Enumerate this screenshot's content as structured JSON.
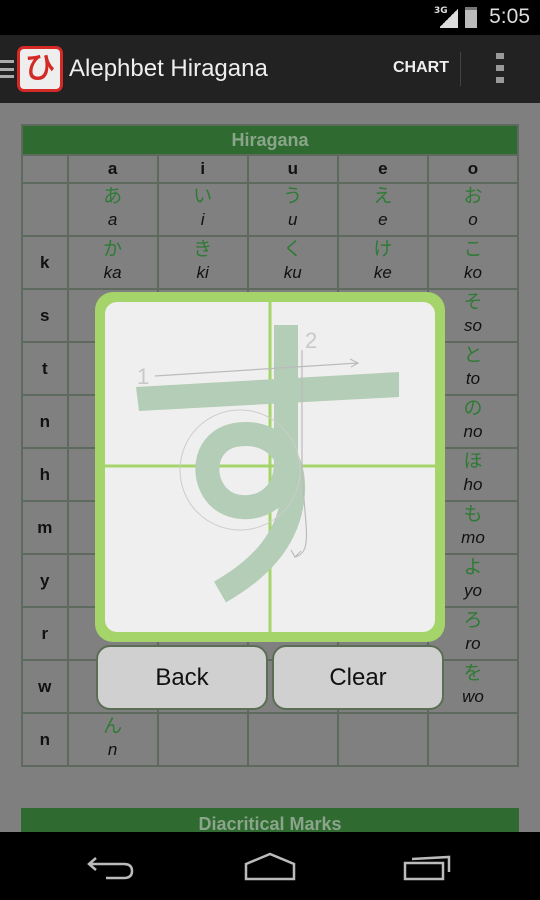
{
  "status_bar": {
    "network": "3G",
    "time": "5:05",
    "icons": [
      "signal-icon",
      "battery-charging-icon"
    ]
  },
  "action_bar": {
    "app_icon_glyph": "ひ",
    "title": "Alephbet Hiragana",
    "chart_label": "CHART",
    "icons": [
      "drawer-icon",
      "overflow-menu-icon"
    ]
  },
  "table": {
    "title": "Hiragana",
    "columns": [
      "a",
      "i",
      "u",
      "e",
      "o"
    ],
    "rows": [
      {
        "label": "",
        "cells": [
          {
            "kana": "あ",
            "romaji": "a"
          },
          {
            "kana": "い",
            "romaji": "i"
          },
          {
            "kana": "う",
            "romaji": "u"
          },
          {
            "kana": "え",
            "romaji": "e"
          },
          {
            "kana": "お",
            "romaji": "o"
          }
        ]
      },
      {
        "label": "k",
        "cells": [
          {
            "kana": "か",
            "romaji": "ka"
          },
          {
            "kana": "き",
            "romaji": "ki"
          },
          {
            "kana": "く",
            "romaji": "ku"
          },
          {
            "kana": "け",
            "romaji": "ke"
          },
          {
            "kana": "こ",
            "romaji": "ko"
          }
        ]
      },
      {
        "label": "s",
        "cells": [
          null,
          null,
          null,
          null,
          {
            "kana": "そ",
            "romaji": "so"
          }
        ]
      },
      {
        "label": "t",
        "cells": [
          null,
          null,
          null,
          null,
          {
            "kana": "と",
            "romaji": "to"
          }
        ]
      },
      {
        "label": "n",
        "cells": [
          null,
          null,
          null,
          null,
          {
            "kana": "の",
            "romaji": "no"
          }
        ]
      },
      {
        "label": "h",
        "cells": [
          null,
          null,
          null,
          null,
          {
            "kana": "ほ",
            "romaji": "ho"
          }
        ]
      },
      {
        "label": "m",
        "cells": [
          null,
          null,
          null,
          null,
          {
            "kana": "も",
            "romaji": "mo"
          }
        ]
      },
      {
        "label": "y",
        "cells": [
          null,
          null,
          null,
          null,
          {
            "kana": "よ",
            "romaji": "yo"
          }
        ]
      },
      {
        "label": "r",
        "cells": [
          null,
          null,
          null,
          null,
          {
            "kana": "ろ",
            "romaji": "ro"
          }
        ]
      },
      {
        "label": "w",
        "cells": [
          null,
          null,
          null,
          null,
          {
            "kana": "を",
            "romaji": "wo"
          }
        ]
      },
      {
        "label": "n",
        "cells": [
          {
            "kana": "ん",
            "romaji": "n"
          },
          null,
          null,
          null,
          null
        ]
      }
    ]
  },
  "next_section": {
    "title": "Diacritical Marks"
  },
  "dialog": {
    "character": "す",
    "stroke_numbers": [
      "1",
      "2"
    ],
    "back_label": "Back",
    "clear_label": "Clear"
  },
  "colors": {
    "frame": "#a5d46a",
    "header": "#2f6a31",
    "kana": "#2f7a35",
    "stroke": "#b3cdb6"
  },
  "nav_bar": {
    "icons": [
      "back-icon",
      "home-icon",
      "recents-icon"
    ]
  }
}
